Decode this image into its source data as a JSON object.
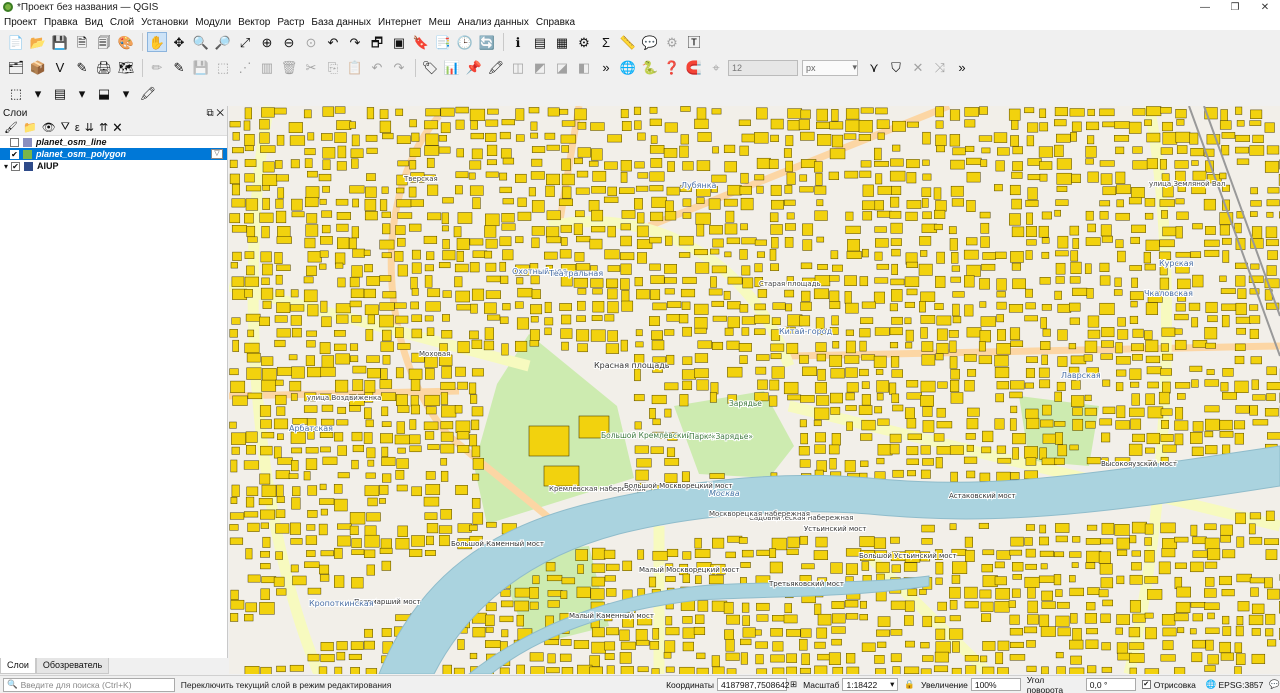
{
  "window": {
    "title": "*Проект без названия — QGIS",
    "controls": [
      "—",
      "❐",
      "✕"
    ]
  },
  "menu": [
    "Проект",
    "Правка",
    "Вид",
    "Слой",
    "Установки",
    "Модули",
    "Вектор",
    "Растр",
    "База данных",
    "Интернет",
    "Меш",
    "Анализ данных",
    "Справка"
  ],
  "toolbar2": {
    "snap_tolerance": "12",
    "snap_units": "px"
  },
  "layers_panel": {
    "title": "Слои",
    "layers": [
      {
        "name": "planet_osm_line",
        "checked": false,
        "selected": false,
        "symbol_color": "#8a8fc0"
      },
      {
        "name": "planet_osm_polygon",
        "checked": true,
        "selected": true,
        "symbol_color": "#7ab648"
      },
      {
        "name": "AIUP",
        "checked": true,
        "selected": false,
        "symbol_color": "#2f4b8a"
      }
    ],
    "tabs": [
      "Слои",
      "Обозреватель"
    ]
  },
  "map": {
    "colors": {
      "background": "#f2efe9",
      "building": "#f2d20e",
      "building_outline": "#4d4000",
      "river": "#aad3df",
      "park": "#cdebb0",
      "main_road": "#f7fabf",
      "secondary_road": "#fcd6a4",
      "rail": "#999999"
    },
    "labels": [
      {
        "text": "Лубянка",
        "kind": "metro"
      },
      {
        "text": "Охотный ряд",
        "kind": "metro"
      },
      {
        "text": "Театральная",
        "kind": "metro"
      },
      {
        "text": "Китай-город",
        "kind": "metro"
      },
      {
        "text": "Красная площадь",
        "kind": "place"
      },
      {
        "text": "Большой Кремлёвский сквер",
        "kind": "park"
      },
      {
        "text": "Парк «Зарядье»",
        "kind": "park"
      },
      {
        "text": "Кремлёвская набережная",
        "kind": "street"
      },
      {
        "text": "Москва",
        "kind": "water"
      },
      {
        "text": "Большой Москворецкий мост",
        "kind": "bridge"
      },
      {
        "text": "Большой Каменный мост",
        "kind": "bridge"
      },
      {
        "text": "Малый Москворецкий мост",
        "kind": "bridge"
      },
      {
        "text": "Большой Устьинский мост",
        "kind": "bridge"
      },
      {
        "text": "Патриарший мост",
        "kind": "bridge"
      },
      {
        "text": "Малый Каменный мост",
        "kind": "bridge"
      },
      {
        "text": "Третьяковский мост",
        "kind": "bridge"
      },
      {
        "text": "Устьинский мост",
        "kind": "bridge"
      },
      {
        "text": "Кропоткинская",
        "kind": "metro"
      },
      {
        "text": "Высокояузский мост",
        "kind": "bridge"
      },
      {
        "text": "Астаковский мост",
        "kind": "bridge"
      },
      {
        "text": "улица Воздвиженка",
        "kind": "street"
      },
      {
        "text": "Моховая",
        "kind": "street"
      },
      {
        "text": "Арбатская",
        "kind": "metro"
      },
      {
        "text": "Курская",
        "kind": "metro"
      },
      {
        "text": "Чкаловская",
        "kind": "metro"
      },
      {
        "text": "Лаврская",
        "kind": "metro"
      },
      {
        "text": "Зарядье",
        "kind": "park"
      },
      {
        "text": "Садовническая набережная",
        "kind": "street"
      },
      {
        "text": "Москворецкая набережная",
        "kind": "street"
      },
      {
        "text": "улица Земляной Вал",
        "kind": "street"
      },
      {
        "text": "Старая площадь",
        "kind": "street"
      },
      {
        "text": "Тверская",
        "kind": "street"
      }
    ]
  },
  "statusbar": {
    "search_placeholder": "Введите для поиска (Ctrl+K)",
    "message": "Переключить текущий слой в режим редактирования",
    "coordinates_label": "Координаты",
    "coordinates_value": "4187987,7508642",
    "scale_label": "Масштаб",
    "scale_value": "1:18422",
    "magnifier_label": "Увеличение",
    "magnifier_value": "100%",
    "rotation_label": "Угол поворота",
    "rotation_value": "0,0 °",
    "render_label": "Отрисовка",
    "crs": "EPSG:3857"
  }
}
